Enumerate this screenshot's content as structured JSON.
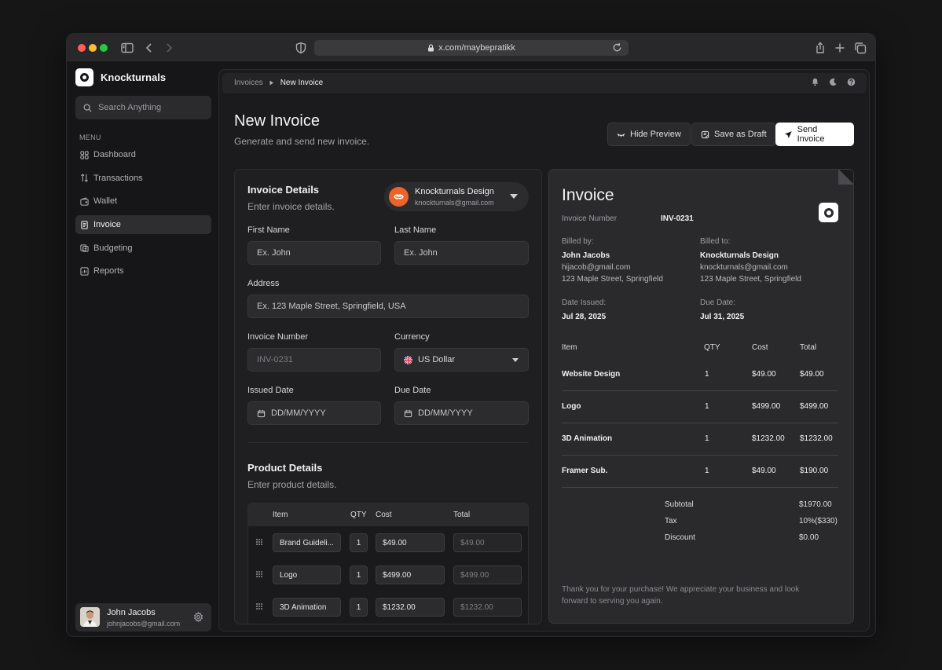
{
  "browser": {
    "url": "x.com/maybepratikk"
  },
  "sidebar": {
    "brand": "Knockturnals",
    "search_placeholder": "Search Anything",
    "menu_label": "MENU",
    "items": [
      {
        "label": "Dashboard",
        "icon": "grid-icon"
      },
      {
        "label": "Transactions",
        "icon": "arrows-updown-icon"
      },
      {
        "label": "Wallet",
        "icon": "wallet-icon"
      },
      {
        "label": "Invoice",
        "icon": "invoice-icon",
        "active": true
      },
      {
        "label": "Budgeting",
        "icon": "budget-icon"
      },
      {
        "label": "Reports",
        "icon": "chart-icon"
      }
    ],
    "user": {
      "name": "John Jacobs",
      "email": "johnjacobs@gmail.com"
    }
  },
  "breadcrumb": {
    "parent": "Invoices",
    "current": "New Invoice"
  },
  "page": {
    "title": "New Invoice",
    "subtitle": "Generate and send new invoice.",
    "hide_preview": "Hide Preview",
    "save_draft": "Save as Draft",
    "send": "Send Invoice"
  },
  "form": {
    "details_title": "Invoice Details",
    "details_sub": "Enter invoice details.",
    "company": {
      "name": "Knockturnals Design",
      "email": "knockturnals@gmail.com"
    },
    "first_name_label": "First Name",
    "first_name_placeholder": "Ex. John",
    "last_name_label": "Last Name",
    "last_name_placeholder": "Ex. John",
    "address_label": "Address",
    "address_placeholder": "Ex. 123 Maple Street, Springfield, USA",
    "invoice_number_label": "Invoice Number",
    "invoice_number_value": "INV-0231",
    "currency_label": "Currency",
    "currency_value": "US Dollar",
    "issued_label": "Issued Date",
    "issued_placeholder": "DD/MM/YYYY",
    "due_label": "Due Date",
    "due_placeholder": "DD/MM/YYYY",
    "product_title": "Product Details",
    "product_sub": "Enter product details.",
    "product_headers": {
      "item": "Item",
      "qty": "QTY",
      "cost": "Cost",
      "total": "Total"
    },
    "products": [
      {
        "item": "Brand Guideli...",
        "qty": "1",
        "cost": "$49.00",
        "total": "$49.00"
      },
      {
        "item": "Logo",
        "qty": "1",
        "cost": "$499.00",
        "total": "$499.00"
      },
      {
        "item": "3D Animation",
        "qty": "1",
        "cost": "$1232.00",
        "total": "$1232.00"
      }
    ]
  },
  "preview": {
    "title": "Invoice",
    "number_label": "Invoice Number",
    "number_value": "INV-0231",
    "billed_by_label": "Billed by:",
    "billed_by": {
      "name": "John Jacobs",
      "email": "hijacob@gmail.com",
      "address": "123 Maple Street, Springfield"
    },
    "billed_to_label": "Billed to:",
    "billed_to": {
      "name": "Knockturnals Design",
      "email": "knockturnals@gmail.com",
      "address": "123 Maple Street, Springfield"
    },
    "issued_label": "Date Issued:",
    "issued_value": "Jul 28, 2025",
    "due_label": "Due Date:",
    "due_value": "Jul 31, 2025",
    "headers": {
      "item": "Item",
      "qty": "QTY",
      "cost": "Cost",
      "total": "Total"
    },
    "items": [
      {
        "item": "Website Design",
        "qty": "1",
        "cost": "$49.00",
        "total": "$49.00"
      },
      {
        "item": "Logo",
        "qty": "1",
        "cost": "$499.00",
        "total": "$499.00"
      },
      {
        "item": "3D Animation",
        "qty": "1",
        "cost": "$1232.00",
        "total": "$1232.00"
      },
      {
        "item": "Framer Sub.",
        "qty": "1",
        "cost": "$49.00",
        "total": "$190.00"
      }
    ],
    "subtotal_label": "Subtotal",
    "subtotal_value": "$1970.00",
    "tax_label": "Tax",
    "tax_value": "10%($330)",
    "discount_label": "Discount",
    "discount_value": "$0.00",
    "thanks": "Thank you for your purchase! We appreciate your business and look forward to serving you again."
  }
}
